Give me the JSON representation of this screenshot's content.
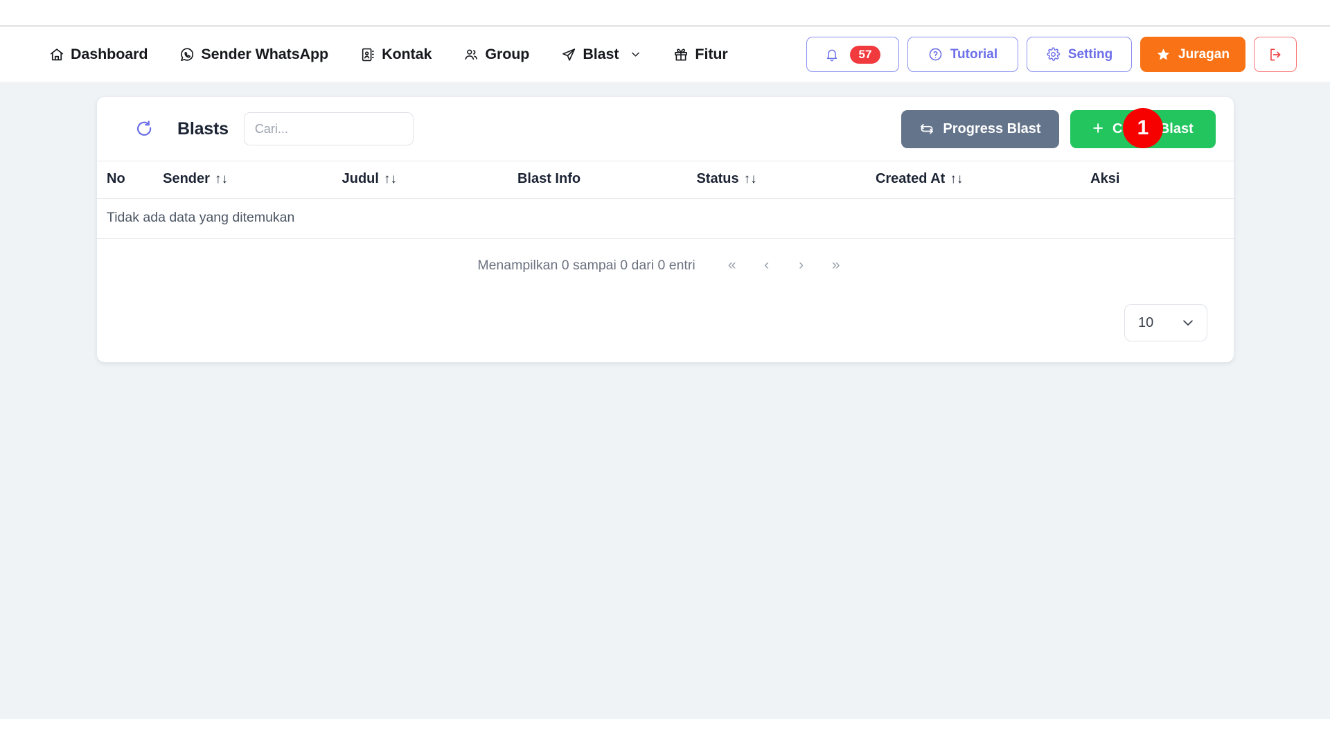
{
  "navbar": {
    "items": [
      {
        "label": "Dashboard",
        "icon": "home-icon",
        "has_chevron": false
      },
      {
        "label": "Sender WhatsApp",
        "icon": "whatsapp-icon",
        "has_chevron": false
      },
      {
        "label": "Kontak",
        "icon": "contact-book-icon",
        "has_chevron": false
      },
      {
        "label": "Group",
        "icon": "users-icon",
        "has_chevron": false
      },
      {
        "label": "Blast",
        "icon": "send-icon",
        "has_chevron": true
      },
      {
        "label": "Fitur",
        "icon": "gift-icon",
        "has_chevron": false
      }
    ],
    "notifications": {
      "icon": "bell-icon",
      "count": "57"
    },
    "tutorial": {
      "label": "Tutorial",
      "icon": "question-circle-icon"
    },
    "setting": {
      "label": "Setting",
      "icon": "gear-icon"
    },
    "juragan": {
      "label": "Juragan",
      "icon": "star-icon"
    },
    "logout": {
      "icon": "logout-icon"
    }
  },
  "card": {
    "refresh_icon": "refresh-icon",
    "title": "Blasts",
    "search": {
      "value": "",
      "placeholder": "Cari..."
    },
    "progress_button": {
      "label": "Progress Blast",
      "icon": "sync-icon"
    },
    "create_button": {
      "label": "Create Blast",
      "icon": "plus-icon"
    },
    "marker": {
      "label": "1"
    }
  },
  "table": {
    "columns": [
      {
        "label": "No",
        "sortable": false
      },
      {
        "label": "Sender",
        "sortable": true
      },
      {
        "label": "Judul",
        "sortable": true
      },
      {
        "label": "Blast Info",
        "sortable": false
      },
      {
        "label": "Status",
        "sortable": true
      },
      {
        "label": "Created At",
        "sortable": true
      },
      {
        "label": "Aksi",
        "sortable": false
      }
    ],
    "sort_glyph": "↑↓",
    "empty_message": "Tidak ada data yang ditemukan",
    "rows": []
  },
  "pagination": {
    "summary": "Menampilkan 0 sampai 0 dari 0 entri",
    "first": "«",
    "prev": "‹",
    "next": "›",
    "last": "»",
    "page_size": "10"
  },
  "colors": {
    "accent_indigo": "#6c6fe8",
    "badge_red": "#f03a3e",
    "orange": "#f97316",
    "green": "#22c55e",
    "slate": "#64748b",
    "logout_red": "#ef4444",
    "page_bg": "#eff3f6",
    "marker_red": "#f60000"
  }
}
